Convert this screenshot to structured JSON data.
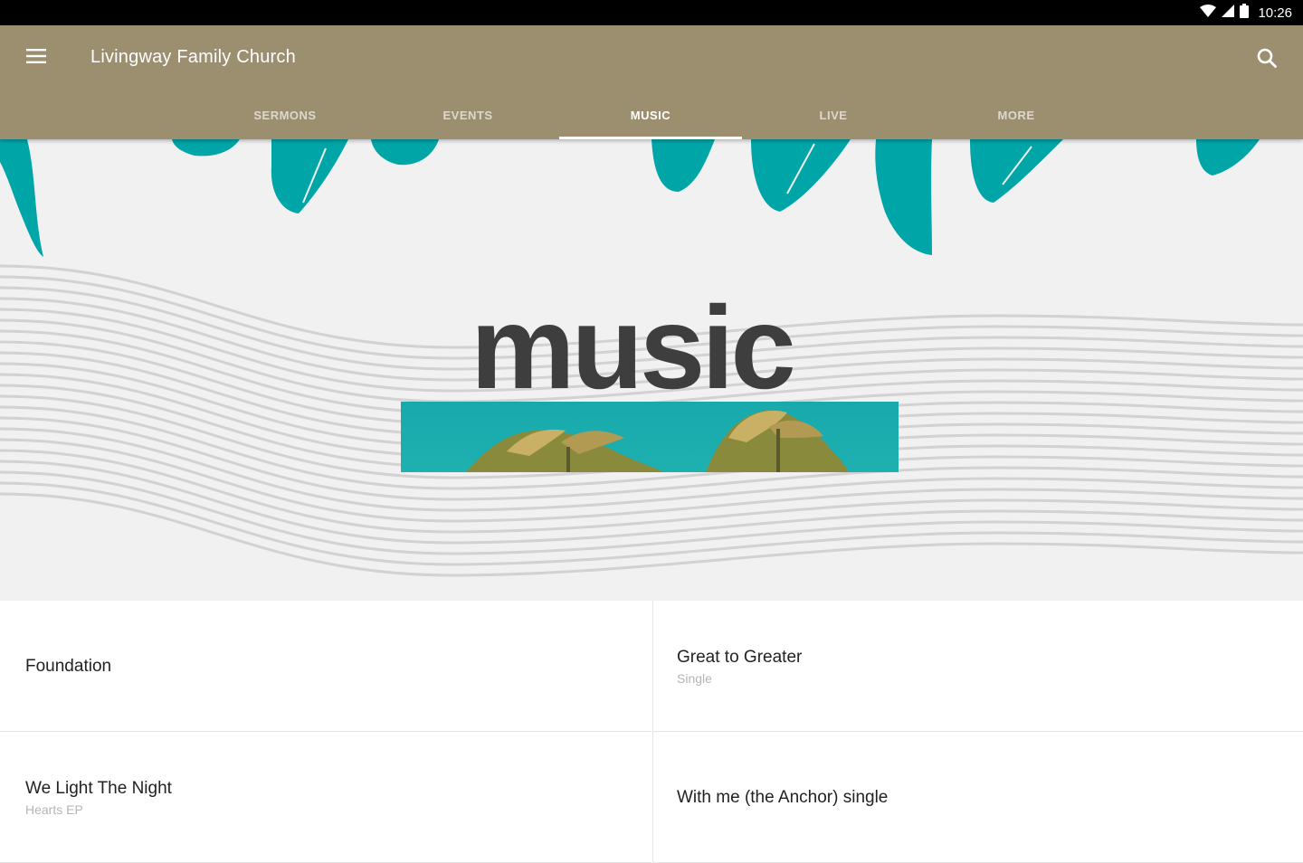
{
  "status_bar": {
    "time": "10:26",
    "icons": [
      "wifi-icon",
      "signal-icon",
      "battery-icon"
    ]
  },
  "app_bar": {
    "title": "Livingway Family Church",
    "menu_icon": "hamburger-menu-icon",
    "search_icon": "search-icon",
    "background_color": "#9c8f70"
  },
  "tabs": [
    {
      "label": "SERMONS",
      "active": false
    },
    {
      "label": "EVENTS",
      "active": false
    },
    {
      "label": "MUSIC",
      "active": true
    },
    {
      "label": "LIVE",
      "active": false
    },
    {
      "label": "MORE",
      "active": false
    }
  ],
  "hero": {
    "title": "music",
    "accent_color": "#00a5a8"
  },
  "music_items": [
    {
      "title": "Foundation",
      "subtitle": ""
    },
    {
      "title": "Great to Greater",
      "subtitle": "Single"
    },
    {
      "title": "We Light The Night",
      "subtitle": "Hearts EP"
    },
    {
      "title": "With me (the Anchor) single",
      "subtitle": ""
    }
  ]
}
